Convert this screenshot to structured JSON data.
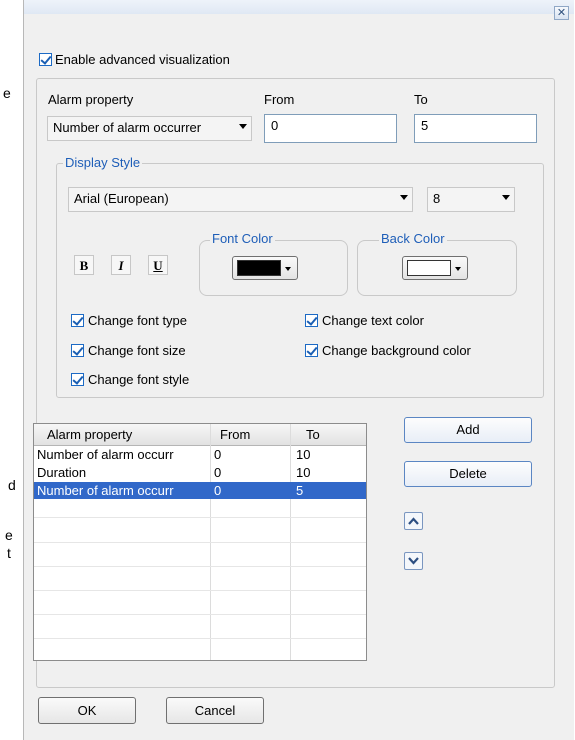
{
  "background_letters": [
    "e",
    "d",
    "e",
    "t"
  ],
  "dialog": {
    "close_glyph": "✕"
  },
  "enable": {
    "label": "Enable advanced visualization",
    "checked": true
  },
  "alarm": {
    "property_header": "Alarm property",
    "from_header": "From",
    "to_header": "To",
    "property_value": "Number of alarm occurrer",
    "from_value": "0",
    "to_value": "5"
  },
  "display_style": {
    "title": "Display Style",
    "font_value": "Arial (European)",
    "size_value": "8",
    "bold": "B",
    "italic": "I",
    "underline": "U",
    "font_color_title": "Font Color",
    "back_color_title": "Back Color",
    "font_color": "#000000",
    "back_color": "#ffffff",
    "checks": {
      "font_type": "Change font type",
      "font_size": "Change font size",
      "font_style": "Change font style",
      "text_color": "Change text color",
      "background_color": "Change background color"
    }
  },
  "table": {
    "columns": [
      "Alarm property",
      "From",
      "To"
    ],
    "rows": [
      [
        "Number of alarm occurr",
        "0",
        "10"
      ],
      [
        "Duration",
        "0",
        "10"
      ],
      [
        "Number of alarm occurr",
        "0",
        "5"
      ]
    ],
    "selected_row": 2,
    "selection_color": "#3168c9"
  },
  "buttons": {
    "add": "Add",
    "delete": "Delete",
    "ok": "OK",
    "cancel": "Cancel"
  },
  "icons": {
    "up": "chevron-up-icon",
    "down": "chevron-down-icon"
  }
}
